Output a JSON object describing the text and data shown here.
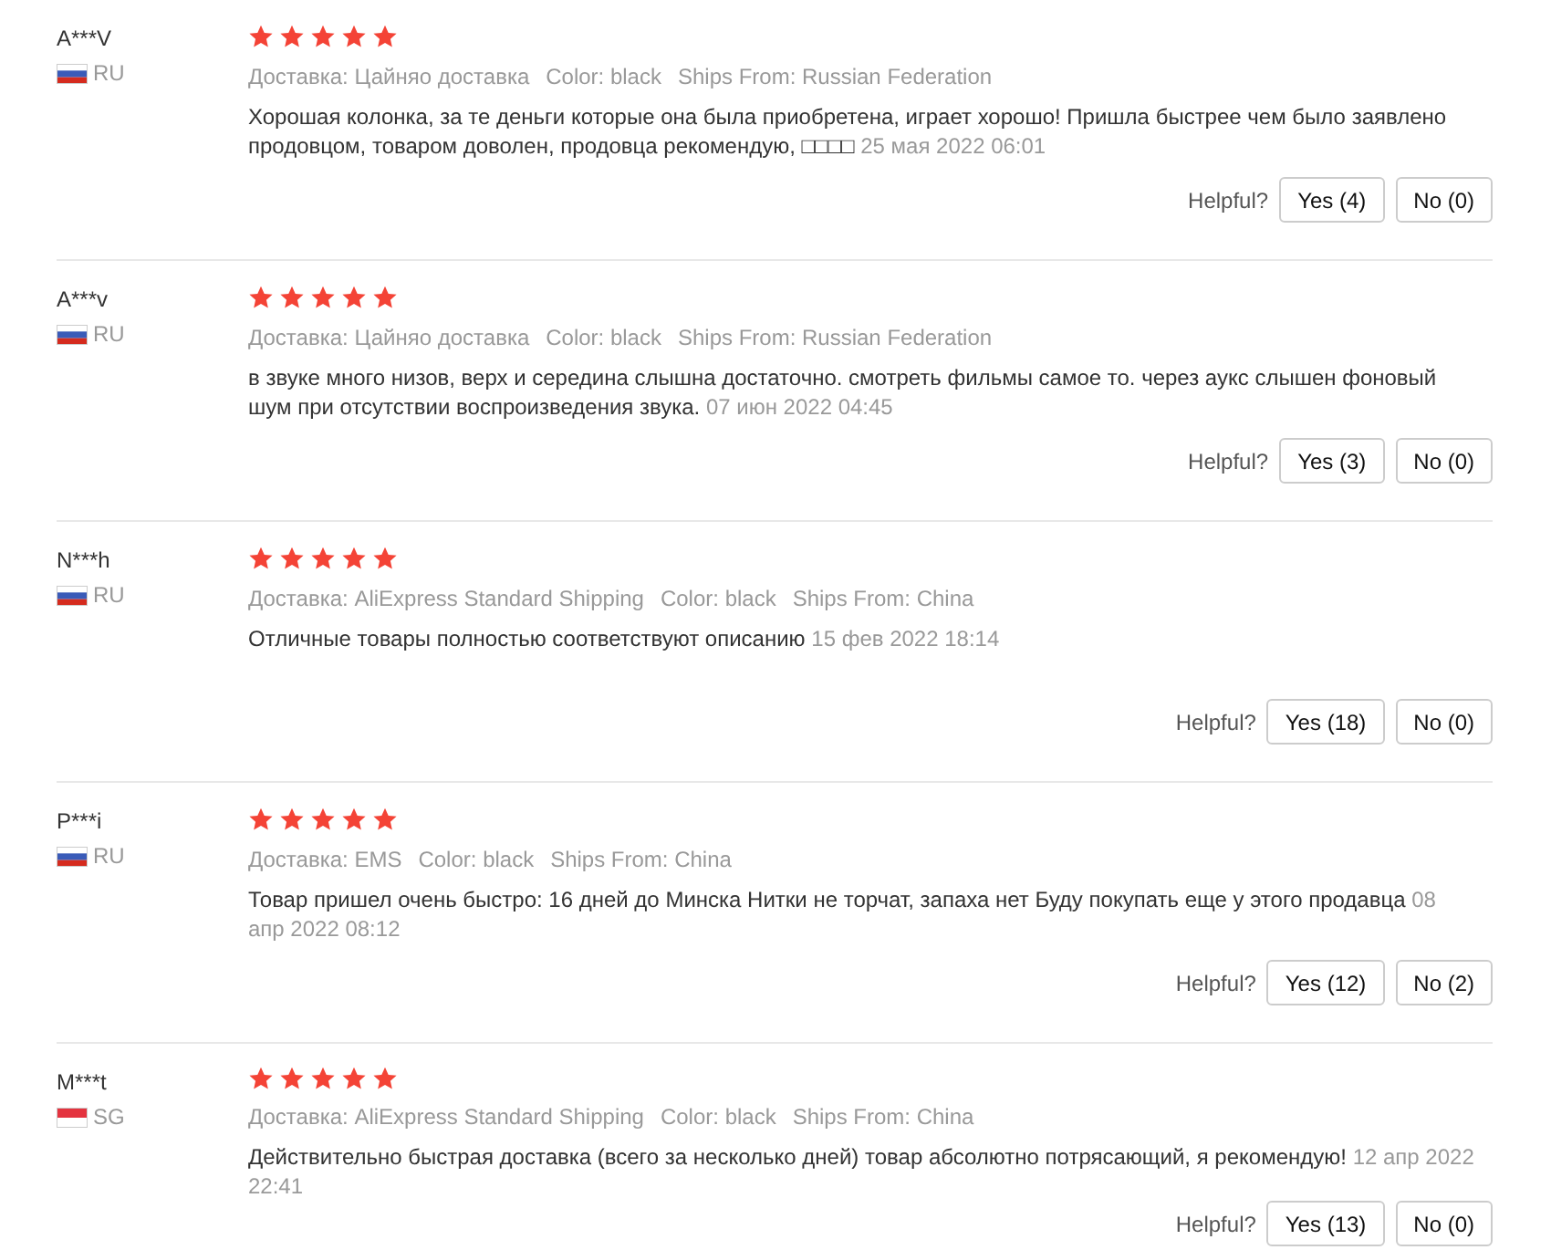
{
  "reviews": [
    {
      "user": "A***V",
      "country": "RU",
      "kind": "ru",
      "stars": 5,
      "meta": [
        {
          "label": "Доставка:",
          "value": "Цайняо доставка"
        },
        {
          "label": "Color:",
          "value": "black"
        },
        {
          "label": "Ships From:",
          "value": "Russian Federation"
        }
      ],
      "text": "Хорошая колонка, за те деньги которые она была приобретена, играет хорошо! Пришла быстрее чем было заявлено продовцом, товаром доволен, продовца рекомендую, □□□□",
      "date": "25 мая 2022 06:01",
      "helpful": "Helpful?",
      "yes": "Yes (4)",
      "no": "No (0)"
    },
    {
      "user": "A***v",
      "country": "RU",
      "kind": "ru",
      "stars": 5,
      "meta": [
        {
          "label": "Доставка:",
          "value": "Цайняо доставка"
        },
        {
          "label": "Color:",
          "value": "black"
        },
        {
          "label": "Ships From:",
          "value": "Russian Federation"
        }
      ],
      "text": "в звуке много низов, верх и середина слышна достаточно. смотреть фильмы самое то. через аукс слышен фоновый шум при отсутствии воспроизведения звука. ",
      "date": "07 июн 2022 04:45",
      "helpful": "Helpful?",
      "yes": "Yes (3)",
      "no": "No (0)"
    },
    {
      "user": "N***h",
      "country": "RU",
      "kind": "ru",
      "stars": 5,
      "meta": [
        {
          "label": "Доставка:",
          "value": "AliExpress Standard Shipping"
        },
        {
          "label": "Color:",
          "value": "black"
        },
        {
          "label": "Ships From:",
          "value": "China"
        }
      ],
      "text": "Отличные товары полностью соответствуют описанию",
      "date": "15 фев 2022 18:14",
      "helpful": "Helpful?",
      "yes": "Yes (18)",
      "no": "No (0)"
    },
    {
      "user": "P***i",
      "country": "RU",
      "kind": "ru",
      "stars": 5,
      "meta": [
        {
          "label": "Доставка:",
          "value": "EMS"
        },
        {
          "label": "Color:",
          "value": "black"
        },
        {
          "label": "Ships From:",
          "value": "China"
        }
      ],
      "text": "Товар пришел очень быстро: 16 дней до Минска Нитки не торчат, запаха нет Буду покупать еще у этого продавца",
      "date": "08 апр 2022 08:12",
      "helpful": "Helpful?",
      "yes": "Yes (12)",
      "no": "No (2)"
    },
    {
      "user": "M***t",
      "country": "SG",
      "kind": "sg",
      "stars": 5,
      "meta": [
        {
          "label": "Доставка:",
          "value": "AliExpress Standard Shipping"
        },
        {
          "label": "Color:",
          "value": "black"
        },
        {
          "label": "Ships From:",
          "value": "China"
        }
      ],
      "text": "Действительно быстрая доставка (всего за несколько дней) товар абсолютно потрясающий, я рекомендую!",
      "date": "12 апр 2022 22:41",
      "helpful": "Helpful?",
      "yes": "Yes (13)",
      "no": "No (0)"
    }
  ]
}
